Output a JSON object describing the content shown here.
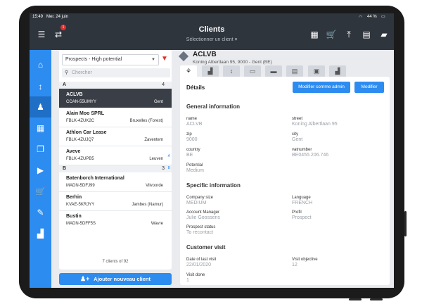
{
  "status": {
    "time": "15:49",
    "date": "Mer. 24 juin",
    "battery": "44 %"
  },
  "header": {
    "title": "Clients",
    "subtitle": "Sélectionner un client",
    "sync_badge": "1",
    "icons": [
      "menu-icon",
      "sync-icon",
      "calendar-add-icon",
      "cart-icon",
      "upload-icon",
      "map-icon",
      "chat-icon"
    ]
  },
  "sidebar": {
    "items": [
      {
        "icon": "home-icon"
      },
      {
        "icon": "sort-icon"
      },
      {
        "icon": "clients-icon",
        "active": true
      },
      {
        "icon": "calendar-icon"
      },
      {
        "icon": "documents-icon"
      },
      {
        "icon": "presentation-icon"
      },
      {
        "icon": "cart-icon"
      },
      {
        "icon": "edit-document-icon"
      },
      {
        "icon": "stats-icon"
      }
    ]
  },
  "client_list": {
    "filter": "Prospects - High potential",
    "search_placeholder": "Chercher",
    "groups": [
      {
        "letter": "A",
        "count": "4",
        "clients": [
          {
            "name": "ACLVB",
            "code": "CCAN-55UMYY",
            "city": "Gent",
            "selected": true
          },
          {
            "name": "Alain Moo SPRL",
            "code": "FBLK-4ZUK2C",
            "city": "Bruxelles (Forest)"
          },
          {
            "name": "Athlon Car Lease",
            "code": "FBLK-4ZUJQ7",
            "city": "Zaventem"
          },
          {
            "name": "Aveve",
            "code": "FBLK-4ZUPB5",
            "city": "Leuven"
          }
        ]
      },
      {
        "letter": "B",
        "count": "3",
        "clients": [
          {
            "name": "Batenborch International",
            "code": "MADN-5DFJ99",
            "city": "Vilvoorde"
          },
          {
            "name": "Berhin",
            "code": "KVAE-5KRJYY",
            "city": "Jambes (Namur)"
          },
          {
            "name": "Bustin",
            "code": "MADN-5DFF5S",
            "city": "Wavre"
          }
        ]
      }
    ],
    "alpha_index": [
      "A",
      "B"
    ],
    "count_label": "7 clients of 92",
    "add_button": "Ajouter nouveau client"
  },
  "detail": {
    "name": "ACLVB",
    "address": "Koning Albertlaan 95, 9000 - Gent (BE)",
    "tabs": [
      "hierarchy-icon",
      "building-icon",
      "sort-icon",
      "card-icon",
      "inbox-icon",
      "clipboard-icon",
      "save-icon",
      "chart-icon"
    ],
    "section_title": "Détails",
    "edit_admin_button": "Modifier comme admin",
    "edit_button": "Modifier",
    "general": {
      "title": "General information",
      "fields": [
        {
          "label": "name",
          "value": "ACLVB"
        },
        {
          "label": "street",
          "value": "Koning Albertlaan 95"
        },
        {
          "label": "zip",
          "value": "9000"
        },
        {
          "label": "city",
          "value": "Gent"
        },
        {
          "label": "country",
          "value": "BE"
        },
        {
          "label": "vatnumber",
          "value": "BE0455.206.746"
        },
        {
          "label": "Potential",
          "value": "Medium"
        }
      ]
    },
    "specific": {
      "title": "Specific information",
      "fields": [
        {
          "label": "Company size",
          "value": "MEDIUM"
        },
        {
          "label": "Language",
          "value": "FRENCH"
        },
        {
          "label": "Account Manager",
          "value": "Julie Goossens"
        },
        {
          "label": "Profil",
          "value": "Prospect"
        },
        {
          "label": "Prospect status",
          "value": "To recontact"
        }
      ]
    },
    "visit": {
      "title": "Customer visit",
      "fields": [
        {
          "label": "Date of last visit",
          "value": "22/01/2020"
        },
        {
          "label": "Visit objective",
          "value": "12"
        },
        {
          "label": "Visit done",
          "value": "1"
        }
      ]
    }
  }
}
